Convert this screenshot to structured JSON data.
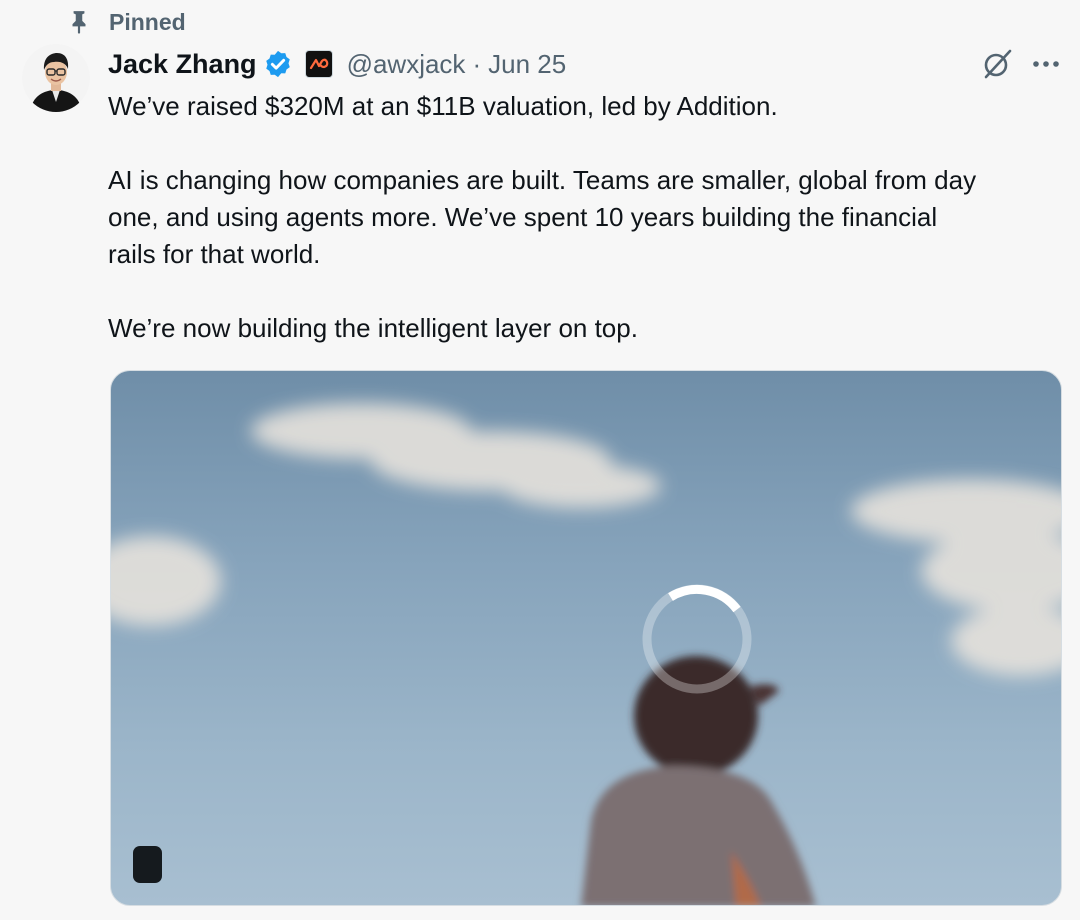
{
  "pinned": {
    "label": "Pinned",
    "icon": "pin-icon"
  },
  "author": {
    "display_name": "Jack Zhang",
    "verified_icon": "verified-badge-icon",
    "affiliate_icon": "airwallex-logo-icon",
    "handle": "@awxjack",
    "separator": "·",
    "date": "Jun 25"
  },
  "actions": {
    "grok_icon": "grok-icon",
    "more_icon": "more-horizontal-icon"
  },
  "tweet": {
    "paragraphs": [
      [
        "We’ve raised $320M at an $11B valuation, led by Addition."
      ],
      [
        "AI is changing how companies are built. Teams are smaller, global from day",
        "one, and using agents more. We’ve spent 10 years building the financial",
        "rails for that world."
      ],
      [
        "We’re now building the intelligent layer on top."
      ]
    ]
  },
  "media": {
    "type": "video",
    "state": "loading",
    "loading_icon": "loading-spinner-icon"
  },
  "colors": {
    "text_primary": "#0f1419",
    "text_secondary": "#536471",
    "verified_blue": "#1d9bf0",
    "background": "#f7f7f7"
  }
}
